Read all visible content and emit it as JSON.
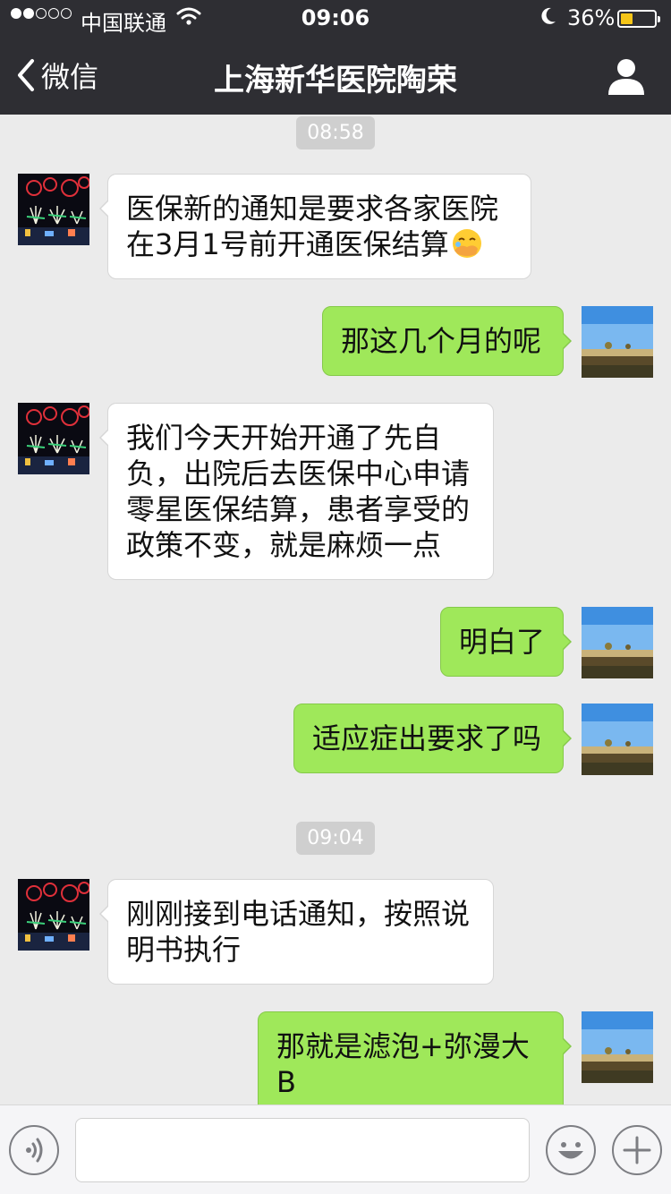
{
  "status_bar": {
    "carrier": "中国联通",
    "time": "09:06",
    "battery_percent": "36%",
    "battery_level": 0.36,
    "signal_bars_filled": 2,
    "signal_bars_total": 5
  },
  "nav": {
    "back_label": "微信",
    "title": "上海新华医院陶荣",
    "back_icon": "chevron-left-icon",
    "profile_icon": "person-icon"
  },
  "chat": {
    "timestamps": [
      "08:58",
      "09:04"
    ],
    "messages": [
      {
        "side": "left",
        "text": "医保新的通知是要求各家医院在3月1号前开通医保结算",
        "emoji": "face-with-hand-over-mouth-icon"
      },
      {
        "side": "right",
        "text": "那这几个月的呢"
      },
      {
        "side": "left",
        "text": "我们今天开始开通了先自负，出院后去医保中心申请零星医保结算，患者享受的政策不变，就是麻烦一点"
      },
      {
        "side": "right",
        "text": "明白了"
      },
      {
        "side": "right",
        "text": "适应症出要求了吗"
      },
      {
        "side": "left",
        "text": "刚刚接到电话通知，按照说明书执行"
      },
      {
        "side": "right",
        "text": "那就是滤泡+弥漫大B"
      }
    ],
    "left_avatar": "fireworks-avatar-icon",
    "right_avatar": "landscape-avatar-icon"
  },
  "input_bar": {
    "voice_icon": "voice-icon",
    "emoji_icon": "smiley-icon",
    "plus_icon": "plus-icon",
    "input_value": ""
  },
  "colors": {
    "topbar": "#2e2e33",
    "chat_bg": "#ebebeb",
    "bubble_right": "#9fe85a",
    "bubble_left": "#ffffff",
    "battery_fill": "#f5c518"
  }
}
